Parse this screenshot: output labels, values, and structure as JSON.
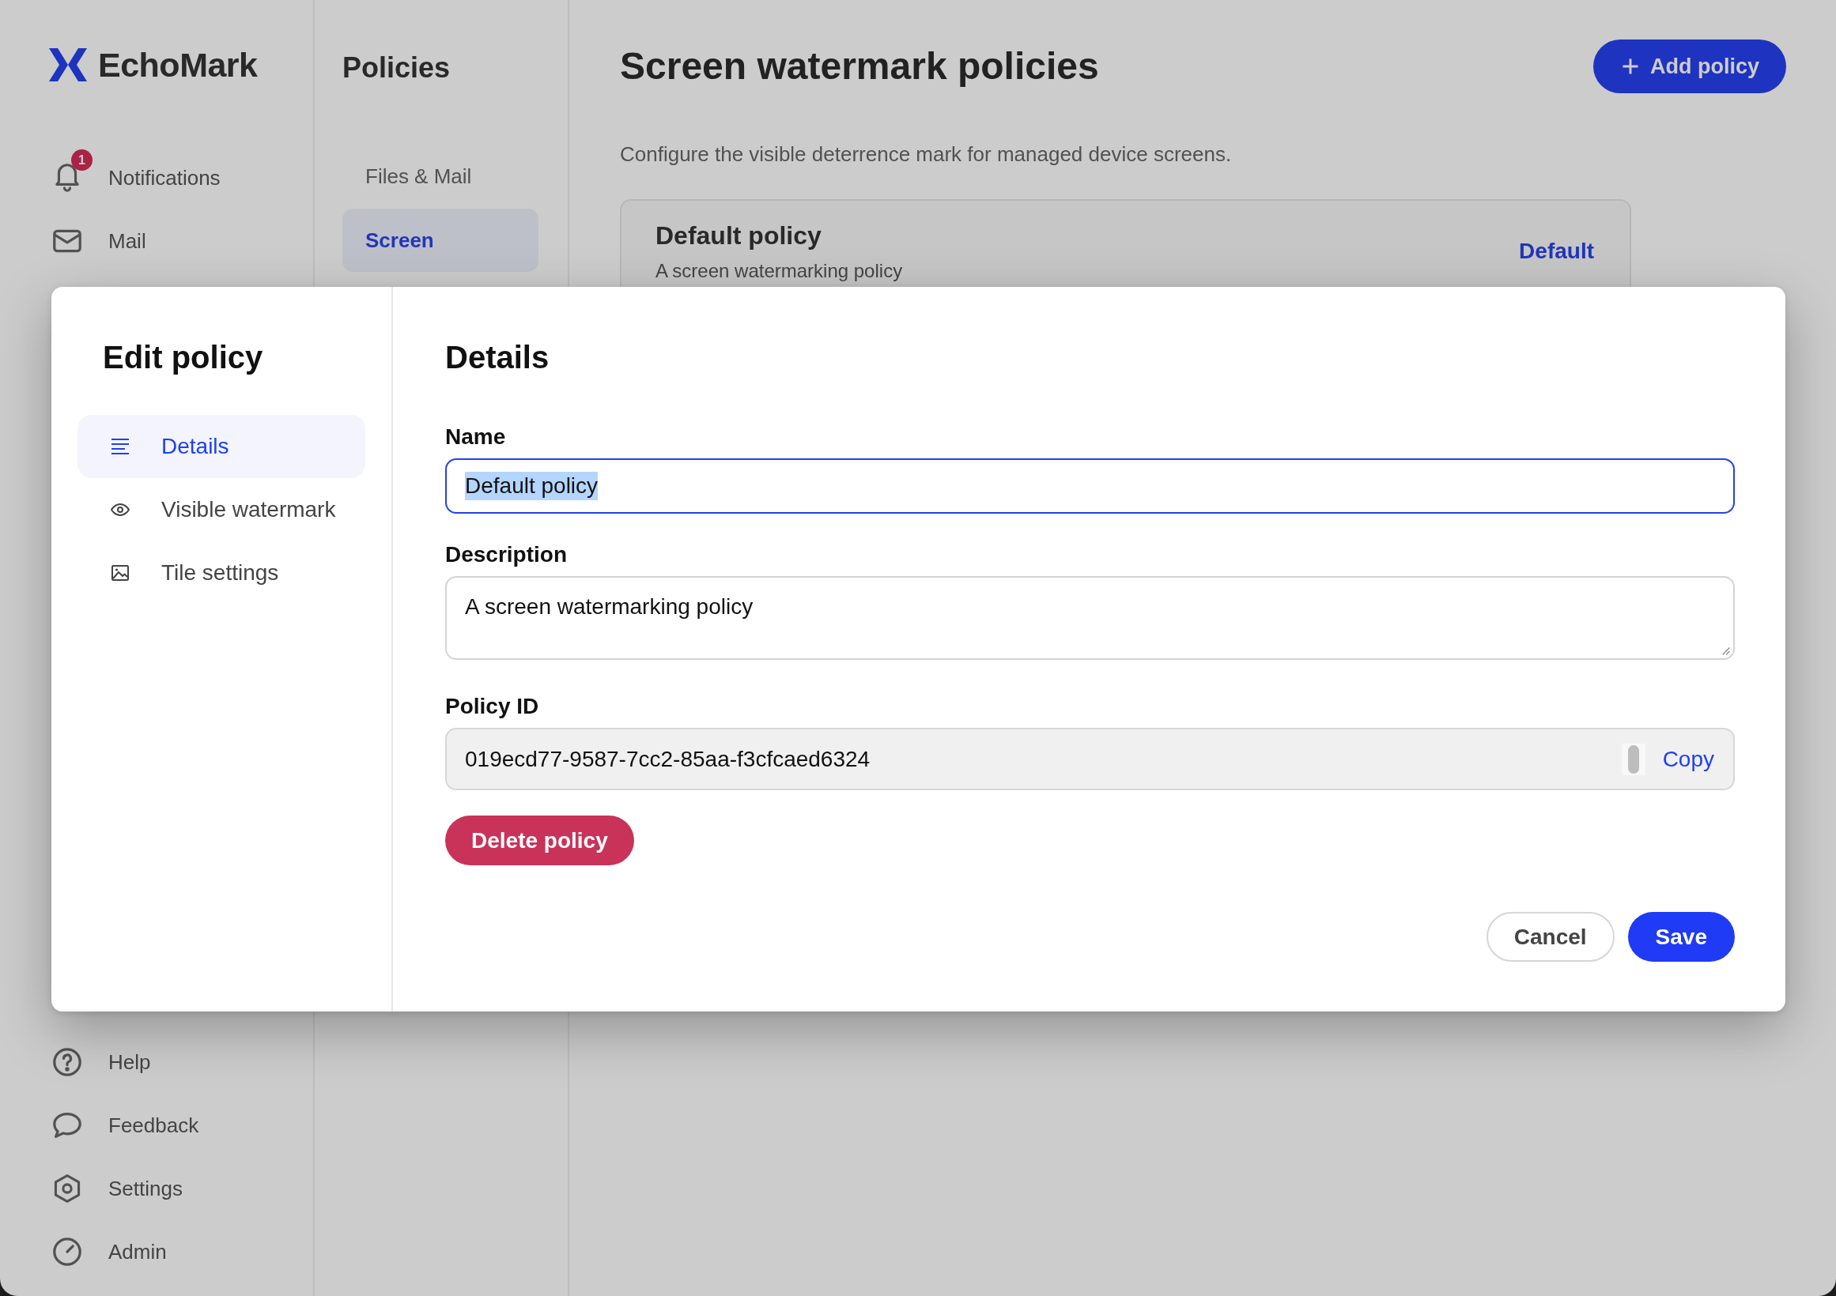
{
  "sidebar": {
    "logo": "EchoMark",
    "top_items": [
      {
        "label": "Notifications",
        "badge": "1"
      },
      {
        "label": "Mail"
      }
    ],
    "bottom_items": [
      {
        "label": "Help"
      },
      {
        "label": "Feedback"
      },
      {
        "label": "Settings"
      },
      {
        "label": "Admin"
      }
    ]
  },
  "policies_nav": {
    "title": "Policies",
    "items": [
      {
        "label": "Files & Mail",
        "selected": false
      },
      {
        "label": "Screen",
        "selected": true
      }
    ]
  },
  "main": {
    "title": "Screen watermark policies",
    "add_button": "Add policy",
    "subtitle": "Configure the visible deterrence mark for managed device screens.",
    "policies": [
      {
        "name": "Default policy",
        "description": "A screen watermarking policy",
        "tag": "Default"
      }
    ]
  },
  "dialog": {
    "title": "Edit policy",
    "sections": [
      {
        "label": "Details",
        "selected": true
      },
      {
        "label": "Visible watermark",
        "selected": false
      },
      {
        "label": "Tile settings",
        "selected": false
      }
    ],
    "heading": "Details",
    "fields": [
      {
        "kind": "text",
        "label": "Name",
        "value": "Default policy",
        "focused": true,
        "text_selected": true
      },
      {
        "kind": "textarea",
        "label": "Description",
        "value": "A screen watermarking policy",
        "focused": false,
        "text_selected": false
      },
      {
        "kind": "readonly",
        "label": "Policy ID",
        "value": "019ecd77-9587-7cc2-85aa-f3cfcaed6324",
        "action": "Copy",
        "focused": false,
        "text_selected": false
      }
    ],
    "delete_button": "Delete policy",
    "cancel_button": "Cancel",
    "save_button": "Save"
  }
}
